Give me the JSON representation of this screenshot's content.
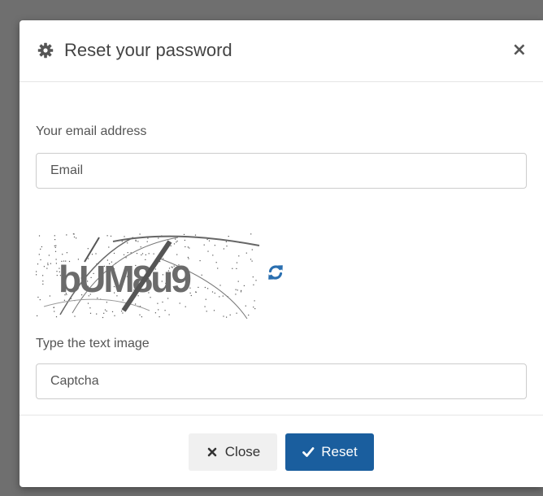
{
  "modal": {
    "title": "Reset your password",
    "close_symbol": "×",
    "header_icon": "gear-icon"
  },
  "form": {
    "email_label": "Your email address",
    "email_placeholder": "Email",
    "email_value": "",
    "captcha_label": "Type the text image",
    "captcha_placeholder": "Captcha",
    "captcha_value": "",
    "captcha_text": "bUM8u9",
    "refresh_icon": "refresh-icon"
  },
  "footer": {
    "close_label": "Close",
    "close_icon": "times-icon",
    "reset_label": "Reset",
    "reset_icon": "check-icon"
  },
  "colors": {
    "primary": "#1a5e9e",
    "refresh": "#2a6fb0",
    "backdrop": "#6f6f6f"
  }
}
